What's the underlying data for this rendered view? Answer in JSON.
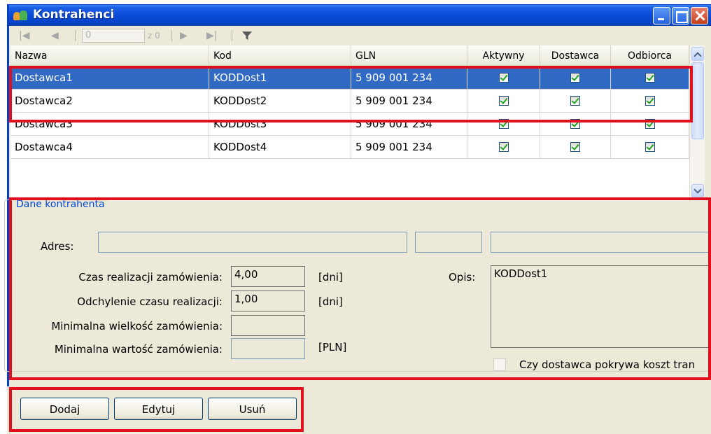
{
  "window": {
    "title": "Kontrahenci"
  },
  "navigator": {
    "position_value": "0",
    "of_label": "z 0"
  },
  "grid": {
    "columns": [
      "Nazwa",
      "Kod",
      "GLN",
      "Aktywny",
      "Dostawca",
      "Odbiorca"
    ],
    "rows": [
      {
        "nazwa": "Dostawca1",
        "kod": "KODDost1",
        "gln": "5 909 001 234",
        "aktywny": true,
        "dostawca": true,
        "odbiorca": true,
        "selected": true
      },
      {
        "nazwa": "Dostawca2",
        "kod": "KODDost2",
        "gln": "5 909 001 234",
        "aktywny": true,
        "dostawca": true,
        "odbiorca": true,
        "selected": false
      },
      {
        "nazwa": "Dostawca3",
        "kod": "KODDost3",
        "gln": "5 909 001 234",
        "aktywny": true,
        "dostawca": true,
        "odbiorca": true,
        "selected": false
      },
      {
        "nazwa": "Dostawca4",
        "kod": "KODDost4",
        "gln": "5 909 001 234",
        "aktywny": true,
        "dostawca": true,
        "odbiorca": true,
        "selected": false
      }
    ]
  },
  "details": {
    "group_label": "Dane kontrahenta",
    "adres_label": "Adres:",
    "adres_value_1": "",
    "adres_value_2": "",
    "adres_value_3": "",
    "czas_label": "Czas realizacji zamówienia:",
    "czas_value": "4,00",
    "czas_unit": "[dni]",
    "odchylenie_label": "Odchylenie czasu realizacji:",
    "odchylenie_value": "1,00",
    "odchylenie_unit": "[dni]",
    "min_wielkosc_label": "Minimalna wielkość zamówienia:",
    "min_wielkosc_value": "",
    "min_wartosc_label": "Minimalna wartość zamówienia:",
    "min_wartosc_value": "",
    "min_wartosc_unit": "[PLN]",
    "opis_label": "Opis:",
    "opis_value": "KODDost1",
    "koszt_label": "Czy dostawca pokrywa koszt tran"
  },
  "buttons": {
    "add": "Dodaj",
    "edit": "Edytuj",
    "delete": "Usuń"
  },
  "colors": {
    "titlebar": "#0a4bd6",
    "selection": "#316ac5",
    "highlight_box": "#e20f1c",
    "window_bg": "#ece9d8"
  }
}
